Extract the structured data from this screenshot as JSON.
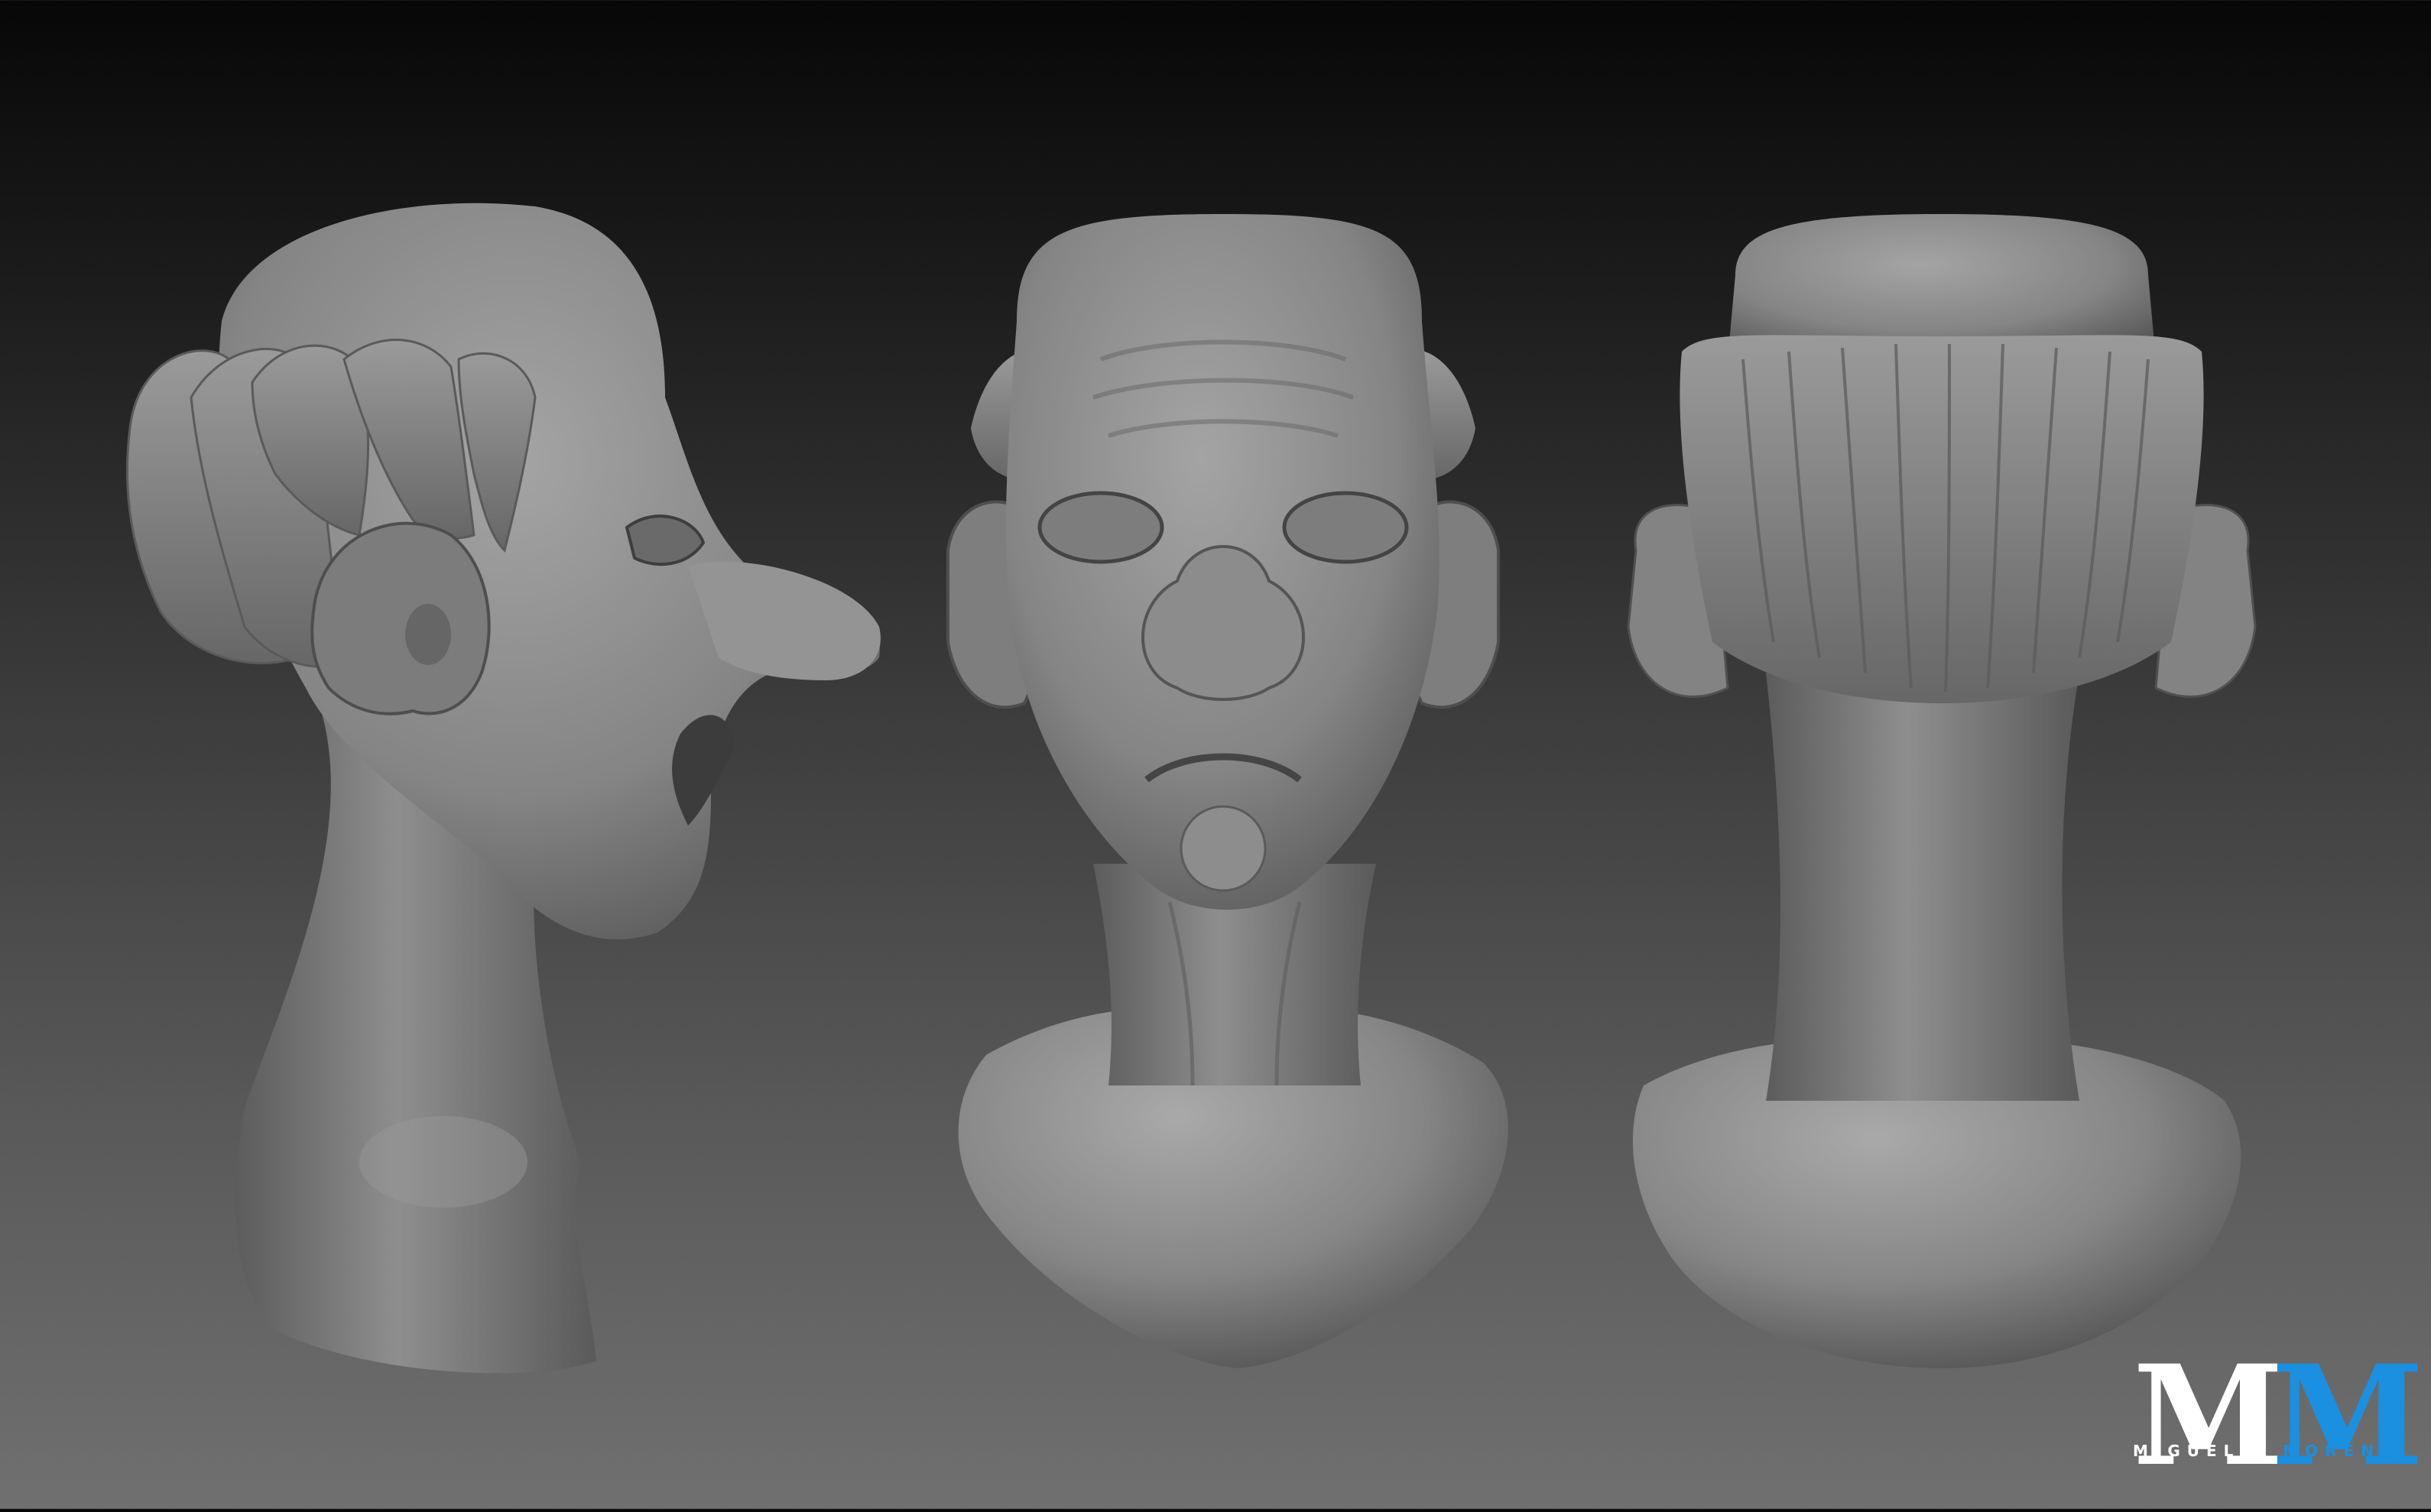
{
  "views": [
    {
      "name": "side-view"
    },
    {
      "name": "front-view"
    },
    {
      "name": "back-view"
    }
  ],
  "colors": {
    "clay_light": "#a8a8a8",
    "clay_mid": "#858585",
    "clay_dark": "#4a4a4a",
    "logo_white": "#ffffff",
    "logo_blue": "#1b8fe0"
  },
  "watermark": {
    "letter_1": "M",
    "letter_2": "M",
    "first_name": "MIGUEL",
    "last_name": "MORENO"
  }
}
